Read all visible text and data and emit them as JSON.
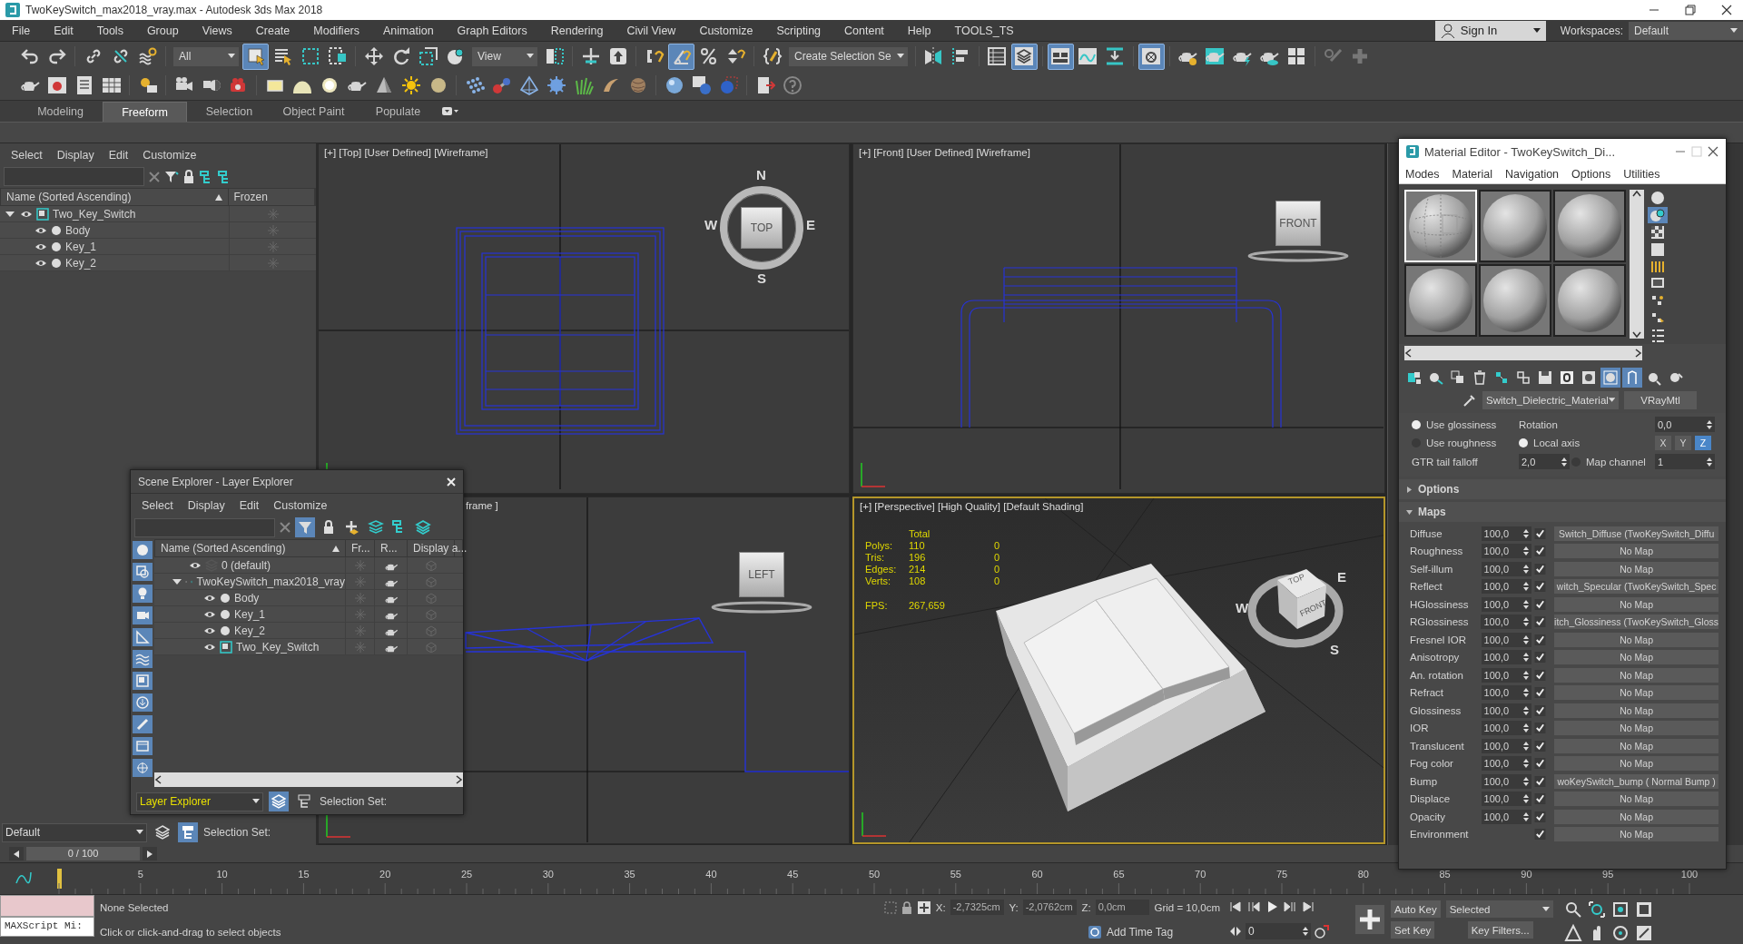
{
  "window": {
    "title": "TwoKeySwitch_max2018_vray.max - Autodesk 3ds Max 2018"
  },
  "menu": [
    "File",
    "Edit",
    "Tools",
    "Group",
    "Views",
    "Create",
    "Modifiers",
    "Animation",
    "Graph Editors",
    "Rendering",
    "Civil View",
    "Customize",
    "Scripting",
    "Content",
    "Help",
    "TOOLS_TS"
  ],
  "account": {
    "label": "Sign In"
  },
  "workspaces": {
    "label": "Workspaces:",
    "value": "Default"
  },
  "main_toolbar": [
    {
      "kind": "button",
      "selected": false
    },
    {
      "kind": "button",
      "selected": false
    },
    {
      "kind": "separator"
    },
    {
      "kind": "button",
      "selected": false
    },
    {
      "kind": "button",
      "selected": false
    },
    {
      "kind": "button",
      "selected": false
    },
    {
      "kind": "separator"
    },
    {
      "kind": "dropdown",
      "value": "All"
    },
    {
      "kind": "button",
      "selected": true
    },
    {
      "kind": "button",
      "selected": false
    },
    {
      "kind": "button",
      "selected": false
    },
    {
      "kind": "button",
      "selected": false
    },
    {
      "kind": "separator"
    },
    {
      "kind": "button",
      "selected": false
    },
    {
      "kind": "button",
      "selected": false
    },
    {
      "kind": "button",
      "selected": false
    },
    {
      "kind": "button",
      "selected": false
    },
    {
      "kind": "dropdown",
      "value": "View"
    },
    {
      "kind": "button",
      "selected": false
    },
    {
      "kind": "separator"
    },
    {
      "kind": "button",
      "selected": false
    },
    {
      "kind": "button",
      "selected": false
    },
    {
      "kind": "separator"
    },
    {
      "kind": "button",
      "selected": false
    },
    {
      "kind": "button",
      "selected": true
    },
    {
      "kind": "button",
      "selected": false
    },
    {
      "kind": "button",
      "selected": false
    },
    {
      "kind": "separator"
    },
    {
      "kind": "button",
      "selected": false
    },
    {
      "kind": "dropdown",
      "value": "Create Selection Se"
    },
    {
      "kind": "separator"
    },
    {
      "kind": "button",
      "selected": false
    },
    {
      "kind": "button",
      "selected": false
    },
    {
      "kind": "separator"
    },
    {
      "kind": "button",
      "selected": false
    },
    {
      "kind": "button",
      "selected": true
    },
    {
      "kind": "separator"
    },
    {
      "kind": "button",
      "selected": true
    },
    {
      "kind": "button",
      "selected": false
    },
    {
      "kind": "button",
      "selected": false
    },
    {
      "kind": "separator"
    },
    {
      "kind": "button",
      "selected": true
    },
    {
      "kind": "separator"
    },
    {
      "kind": "button",
      "selected": false
    },
    {
      "kind": "button",
      "selected": false
    },
    {
      "kind": "button",
      "selected": false
    },
    {
      "kind": "button",
      "selected": false
    },
    {
      "kind": "button",
      "selected": false
    },
    {
      "kind": "separator"
    },
    {
      "kind": "button",
      "selected": false
    },
    {
      "kind": "button",
      "selected": false
    }
  ],
  "ribbon_tabs": [
    {
      "label": "Modeling",
      "selected": false
    },
    {
      "label": "Freeform",
      "selected": true
    },
    {
      "label": "Selection",
      "selected": false
    },
    {
      "label": "Object Paint",
      "selected": false
    },
    {
      "label": "Populate",
      "selected": false
    }
  ],
  "scene_explorer": {
    "menu": [
      "Select",
      "Display",
      "Edit",
      "Customize"
    ],
    "columns": [
      "Name (Sorted Ascending)",
      "Frozen"
    ],
    "tree": [
      {
        "name": "Two_Key_Switch",
        "kind": "group",
        "expanded": true,
        "children": [
          {
            "name": "Body",
            "kind": "object"
          },
          {
            "name": "Key_1",
            "kind": "object"
          },
          {
            "name": "Key_2",
            "kind": "object"
          }
        ]
      }
    ],
    "layer": "Default",
    "selection_set": "Selection Set:"
  },
  "viewports": [
    {
      "kind": "top",
      "label": "[+] [Top] [User Defined] [Wireframe]",
      "active": false,
      "cube": {
        "face": "TOP",
        "compass": [
          "N",
          "E",
          "S",
          "W"
        ]
      }
    },
    {
      "kind": "front",
      "label": "[+] [Front] [User Defined] [Wireframe]",
      "active": false,
      "cube": {
        "face": "FRONT"
      }
    },
    {
      "kind": "left",
      "label": "frame ]",
      "active": false,
      "cube": {
        "face": "LEFT"
      }
    },
    {
      "kind": "perspective",
      "label": "[+] [Perspective] [High Quality] [Default Shading]",
      "active": true,
      "cube": {
        "face": "TOP",
        "side": "FRONT",
        "compass": [
          "E",
          "S",
          "W"
        ]
      },
      "stats": {
        "header": "Total",
        "rows": [
          {
            "label": "Polys:",
            "total": "110",
            "selected": "0"
          },
          {
            "label": "Tris:",
            "total": "196",
            "selected": "0"
          },
          {
            "label": "Edges:",
            "total": "214",
            "selected": "0"
          },
          {
            "label": "Verts:",
            "total": "108",
            "selected": "0"
          }
        ],
        "fps_label": "FPS:",
        "fps": "267,659"
      }
    }
  ],
  "layer_explorer": {
    "title": "Scene Explorer - Layer Explorer",
    "menu": [
      "Select",
      "Display",
      "Edit",
      "Customize"
    ],
    "tools": [
      {
        "selected": true
      },
      {
        "selected": false
      },
      {
        "selected": false
      },
      {
        "selected": false
      },
      {
        "selected": false
      },
      {
        "selected": false
      }
    ],
    "filters": [
      {
        "on": true
      },
      {
        "on": true
      },
      {
        "on": true
      },
      {
        "on": true
      },
      {
        "on": true
      },
      {
        "on": true
      },
      {
        "on": true
      },
      {
        "on": true
      },
      {
        "on": true
      },
      {
        "on": true
      },
      {
        "on": true
      }
    ],
    "columns": [
      "Name (Sorted Ascending)",
      "Fr...",
      "R...",
      "Display a..."
    ],
    "tree": [
      {
        "name": "0 (default)",
        "kind": "layer",
        "expanded": false
      },
      {
        "name": "TwoKeySwitch_max2018_vray",
        "kind": "layer",
        "expanded": true,
        "children": [
          {
            "name": "Body",
            "kind": "object"
          },
          {
            "name": "Key_1",
            "kind": "object"
          },
          {
            "name": "Key_2",
            "kind": "object"
          },
          {
            "name": "Two_Key_Switch",
            "kind": "group"
          }
        ]
      }
    ],
    "mode": "Layer Explorer",
    "mode_tools": [
      {
        "selected": true
      },
      {
        "selected": false
      }
    ],
    "selection_set": "Selection Set:"
  },
  "material_editor": {
    "title": "Material Editor - TwoKeySwitch_Di...",
    "menu": [
      "Modes",
      "Material",
      "Navigation",
      "Options",
      "Utilities"
    ],
    "slots": [
      {
        "selected": true,
        "kind": "textured"
      },
      {
        "selected": false,
        "kind": "plain"
      },
      {
        "selected": false,
        "kind": "plain"
      },
      {
        "selected": false,
        "kind": "plain"
      },
      {
        "selected": false,
        "kind": "plain"
      },
      {
        "selected": false,
        "kind": "plain"
      }
    ],
    "side_tools": [
      {
        "selected": false
      },
      {
        "selected": true
      },
      {
        "selected": false
      },
      {
        "selected": false
      },
      {
        "selected": false
      },
      {
        "selected": false
      },
      {
        "selected": false
      },
      {
        "selected": false
      },
      {
        "selected": false
      }
    ],
    "tools": [
      {
        "selected": false
      },
      {
        "selected": false
      },
      {
        "selected": false
      },
      {
        "selected": false
      },
      {
        "selected": false
      },
      {
        "selected": false
      },
      {
        "selected": false
      },
      {
        "selected": false
      },
      {
        "selected": false
      },
      {
        "selected": true
      },
      {
        "selected": true
      },
      {
        "selected": false
      },
      {
        "selected": false
      }
    ],
    "material_name": "Switch_Dielectric_Material",
    "material_type": "VRayMtl",
    "params": {
      "modes": [
        {
          "label": "Use glossiness",
          "selected": true
        },
        {
          "label": "Use roughness",
          "selected": false
        }
      ],
      "rotation": {
        "label": "Rotation",
        "value": "0,0"
      },
      "local_axis": {
        "label": "Local axis",
        "selected": true
      },
      "axes": [
        {
          "label": "X",
          "selected": false
        },
        {
          "label": "Y",
          "selected": false
        },
        {
          "label": "Z",
          "selected": true
        }
      ],
      "gtr": {
        "label": "GTR tail falloff",
        "value": "2,0"
      },
      "map_channel": {
        "label": "Map channel",
        "selected": false,
        "value": "1"
      }
    },
    "rollouts": [
      {
        "label": "Options",
        "expanded": false
      },
      {
        "label": "Maps",
        "expanded": true
      }
    ],
    "maps": [
      {
        "name": "Diffuse",
        "amount": "100,0",
        "enabled": true,
        "map": "Switch_Diffuse (TwoKeySwitch_Diffu"
      },
      {
        "name": "Roughness",
        "amount": "100,0",
        "enabled": true,
        "map": "No Map"
      },
      {
        "name": "Self-illum",
        "amount": "100,0",
        "enabled": true,
        "map": "No Map"
      },
      {
        "name": "Reflect",
        "amount": "100,0",
        "enabled": true,
        "map": "witch_Specular (TwoKeySwitch_Spec"
      },
      {
        "name": "HGlossiness",
        "amount": "100,0",
        "enabled": true,
        "map": "No Map"
      },
      {
        "name": "RGlossiness",
        "amount": "100,0",
        "enabled": true,
        "map": "itch_Glossiness (TwoKeySwitch_Gloss"
      },
      {
        "name": "Fresnel IOR",
        "amount": "100,0",
        "enabled": true,
        "map": "No Map"
      },
      {
        "name": "Anisotropy",
        "amount": "100,0",
        "enabled": true,
        "map": "No Map"
      },
      {
        "name": "An. rotation",
        "amount": "100,0",
        "enabled": true,
        "map": "No Map"
      },
      {
        "name": "Refract",
        "amount": "100,0",
        "enabled": true,
        "map": "No Map"
      },
      {
        "name": "Glossiness",
        "amount": "100,0",
        "enabled": true,
        "map": "No Map"
      },
      {
        "name": "IOR",
        "amount": "100,0",
        "enabled": true,
        "map": "No Map"
      },
      {
        "name": "Translucent",
        "amount": "100,0",
        "enabled": true,
        "map": "No Map"
      },
      {
        "name": "Fog color",
        "amount": "100,0",
        "enabled": true,
        "map": "No Map"
      },
      {
        "name": "Bump",
        "amount": "100,0",
        "enabled": true,
        "map": "woKeySwitch_bump ( Normal Bump )"
      },
      {
        "name": "Displace",
        "amount": "100,0",
        "enabled": true,
        "map": "No Map"
      },
      {
        "name": "Opacity",
        "amount": "100,0",
        "enabled": true,
        "map": "No Map"
      },
      {
        "name": "Environment",
        "enabled": true,
        "map": "No Map"
      }
    ]
  },
  "time_slider": {
    "label": "0 / 100",
    "level": 0
  },
  "trackbar": {
    "labels": [
      "5",
      "10",
      "15",
      "20",
      "25",
      "30",
      "35",
      "40",
      "45",
      "50",
      "55",
      "60",
      "65",
      "70",
      "75",
      "80",
      "85",
      "90",
      "95",
      "100"
    ]
  },
  "status_bar": {
    "listener": "MAXScript Mi:",
    "selection": "None Selected",
    "prompt": "Click or click-and-drag to select objects",
    "coords": [
      {
        "label": "X:",
        "value": "-2,7325cm"
      },
      {
        "label": "Y:",
        "value": "-2,0762cm"
      },
      {
        "label": "Z:",
        "value": "0,0cm"
      }
    ],
    "grid": "Grid = 10,0cm",
    "time_tag": "Add Time Tag",
    "frame": "0",
    "auto_key": "Auto Key",
    "key_mode": "Selected",
    "set_key": "Set Key",
    "key_filters": "Key Filters..."
  }
}
